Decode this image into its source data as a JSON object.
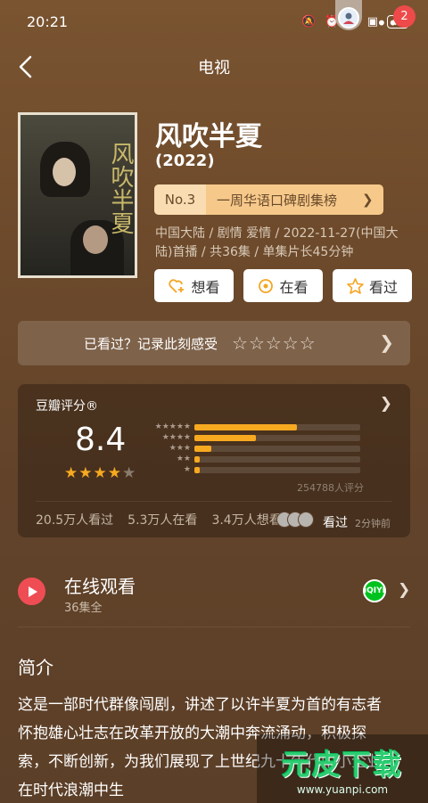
{
  "status_bar": {
    "time": "20:21",
    "battery": "47"
  },
  "header": {
    "title": "电视",
    "notification_count": "2"
  },
  "show": {
    "title": "风吹半夏",
    "year": "(2022)",
    "poster_title": "风吹半夏",
    "rank": {
      "number": "No.3",
      "text": "一周华语口碑剧集榜"
    },
    "meta": "中国大陆 / 剧情 爱情 / 2022-11-27(中国大陆)首播 / 共36集 / 单集片长45分钟"
  },
  "actions": [
    {
      "label": "想看",
      "icon": "heart-plus-icon"
    },
    {
      "label": "在看",
      "icon": "target-circle-icon"
    },
    {
      "label": "看过",
      "icon": "star-outline-icon"
    }
  ],
  "seen_prompt": {
    "label": "已看过？记录此刻感受",
    "stars": "☆☆☆☆☆"
  },
  "rating": {
    "title": "豆瓣评分®",
    "score": "8.4",
    "score_stars": {
      "filled": "★★★★",
      "empty": "★"
    },
    "distribution": [
      {
        "stars": "★★★★★",
        "fraction": 0.62
      },
      {
        "stars": "★★★★",
        "fraction": 0.37
      },
      {
        "stars": "★★★",
        "fraction": 0.1
      },
      {
        "stars": "★★",
        "fraction": 0.03
      },
      {
        "stars": "★",
        "fraction": 0.03
      }
    ],
    "votes": "254788人评分",
    "watch_stats": [
      "20.5万人看过",
      "5.3万人在看",
      "3.4万人想看"
    ],
    "friend_status": "看过",
    "friend_time": "2分钟前"
  },
  "online_watch": {
    "title": "在线观看",
    "subtitle": "36集全",
    "platform": "iQIYI"
  },
  "intro": {
    "title": "简介",
    "text": "这是一部时代群像闯剧，讲述了以许半夏为首的有志者怀抱雄心壮志在改革开放的大潮中奔流涌动，积极探索，不断创新，为我们展现了上世纪九十年代中小企业在时代浪潮中生"
  },
  "watermark": {
    "main": "元皮下载",
    "sub": "www.yuanpi.com"
  }
}
